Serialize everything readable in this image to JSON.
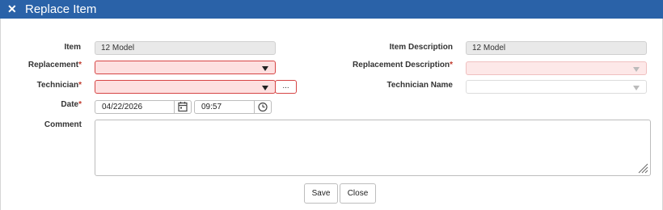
{
  "dialog": {
    "title": "Replace Item",
    "close_glyph": "✕"
  },
  "form": {
    "item": {
      "label": "Item",
      "value": "12 Model"
    },
    "item_description": {
      "label": "Item Description",
      "value": "12 Model"
    },
    "replacement": {
      "label": "Replacement",
      "required_mark": "*",
      "value": ""
    },
    "replacement_description": {
      "label": "Replacement Description",
      "required_mark": "*",
      "value": ""
    },
    "technician": {
      "label": "Technician",
      "required_mark": "*",
      "value": "",
      "lookup_label": "..."
    },
    "technician_name": {
      "label": "Technician Name",
      "value": ""
    },
    "date": {
      "label": "Date",
      "required_mark": "*",
      "date_value": "04/22/2026",
      "time_value": "09:57"
    },
    "comment": {
      "label": "Comment",
      "value": ""
    }
  },
  "buttons": {
    "save": "Save",
    "close": "Close"
  },
  "colors": {
    "titlebar": "#2a62a8",
    "required": "#c0392b",
    "error_fill": "#fde0e0",
    "error_border": "#d64545"
  },
  "icons": [
    "close-icon",
    "dropdown-caret-icon",
    "calendar-icon",
    "clock-icon",
    "resize-grip-icon"
  ]
}
